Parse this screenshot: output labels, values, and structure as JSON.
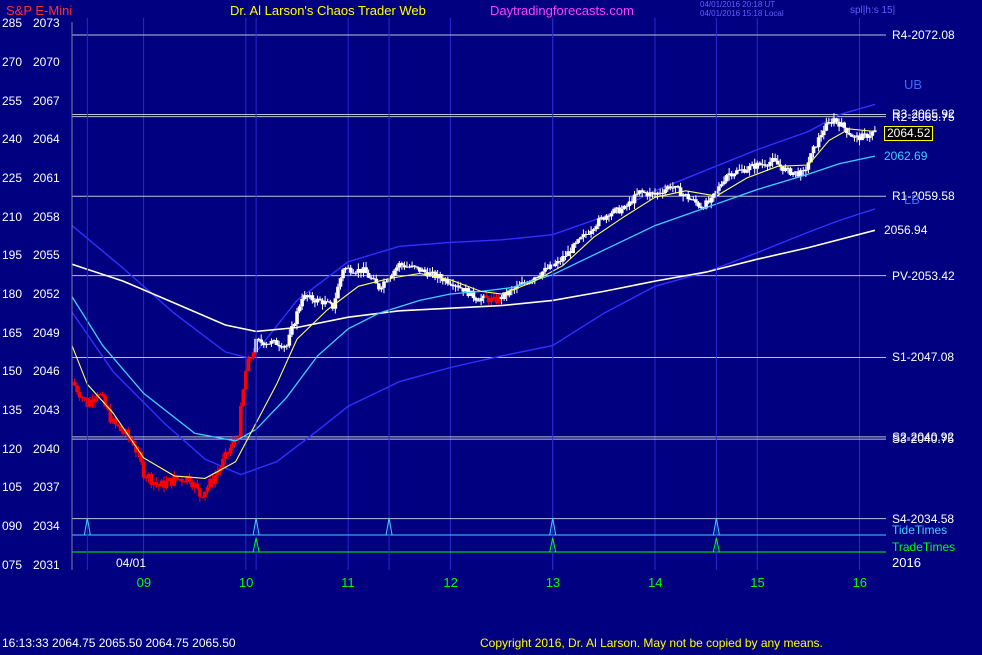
{
  "header": {
    "symbol": "S&P E-Mini",
    "title": "Dr. Al Larson's Chaos Trader Web",
    "site": "Daytradingforecasts.com",
    "stamp_line1": "04/01/2016 20:18 UT",
    "stamp_line2": "04/01/2016 15:18 Local",
    "spl": "spl|h:s 15|"
  },
  "footer": {
    "quote": "16:13:33  2064.75  2065.50  2064.75  2065.50",
    "copyright": "Copyright 2016, Dr. Al Larson. May not be copied by any means."
  },
  "date_label": "04/01",
  "year_label": "2016",
  "colors": {
    "background": "#000080",
    "up_candle": "#ffffff",
    "down_candle": "#ff0000",
    "level_line": "#c0c0d8",
    "ema_short": "#ffff66",
    "ema_mid": "#40d0ff",
    "ema_long": "#ffffe0",
    "band": "#3030ff",
    "tide": "#40d0ff",
    "trade": "#00ff00",
    "symbol": "#ff3030",
    "title": "#ffff00",
    "site": "#ff40ff"
  },
  "chart_data": {
    "type": "candlestick",
    "title": "S&P E-Mini",
    "y_axis_price": {
      "ticks": [
        2031,
        2034,
        2037,
        2040,
        2043,
        2046,
        2049,
        2052,
        2055,
        2058,
        2061,
        2064,
        2067,
        2070,
        2073
      ],
      "labels": [
        "2031",
        "2034",
        "2037",
        "2040",
        "2043",
        "2046",
        "2049",
        "2052",
        "2055",
        "2058",
        "2061",
        "2064",
        "2067",
        "2070",
        "2073"
      ],
      "range": [
        2030.6,
        2073.4
      ]
    },
    "y_axis_index": [
      "075",
      "090",
      "105",
      "120",
      "135",
      "150",
      "165",
      "180",
      "195",
      "210",
      "225",
      "240",
      "255",
      "270",
      "285"
    ],
    "x_axis": {
      "range": [
        8.3,
        16.2
      ],
      "ticks": [
        9,
        10,
        11,
        12,
        13,
        14,
        15,
        16
      ],
      "labels": [
        "09",
        "10",
        "11",
        "12",
        "13",
        "14",
        "15",
        "16"
      ],
      "hour_grid": true
    },
    "levels": [
      {
        "name": "R4",
        "label": "R4-2072.08",
        "value": 2072.08
      },
      {
        "name": "R3",
        "label": "R3-2065.92",
        "value": 2065.92
      },
      {
        "name": "R2",
        "label": "R2-2065.75",
        "value": 2065.75
      },
      {
        "name": "R1",
        "label": "R1-2059.58",
        "value": 2059.58
      },
      {
        "name": "PV",
        "label": "PV-2053.42",
        "value": 2053.42
      },
      {
        "name": "S1",
        "label": "S1-2047.08",
        "value": 2047.08
      },
      {
        "name": "S2",
        "label": "S2-2040.92",
        "value": 2040.92
      },
      {
        "name": "S3",
        "label": "S3-2040.75",
        "value": 2040.75
      },
      {
        "name": "S4",
        "label": "S4-2034.58",
        "value": 2034.58
      }
    ],
    "value_labels": [
      {
        "label": "2064.52",
        "value": 2064.52,
        "color": "#ffffff",
        "box": true
      },
      {
        "label": "2062.69",
        "value": 2062.69,
        "color": "#40d0ff",
        "box": false
      },
      {
        "label": "2056.94",
        "value": 2056.94,
        "color": "#ffffff",
        "box": false
      }
    ],
    "band_labels": {
      "upper": "UB",
      "lower": "LB"
    },
    "tide_times": {
      "label": "TideTimes",
      "times": [
        8.45,
        10.1,
        11.4,
        13.0,
        14.6
      ]
    },
    "trade_times": {
      "label": "TradeTimes",
      "times": [
        10.1,
        13.0,
        14.6
      ]
    },
    "candle_path": [
      [
        8.3,
        2045.2
      ],
      [
        8.45,
        2043.5
      ],
      [
        8.55,
        2044.5
      ],
      [
        8.7,
        2042.0
      ],
      [
        8.9,
        2040.5
      ],
      [
        9.0,
        2038.2
      ],
      [
        9.15,
        2037.1
      ],
      [
        9.3,
        2037.6
      ],
      [
        9.45,
        2037.8
      ],
      [
        9.55,
        2036.4
      ],
      [
        9.65,
        2037.3
      ],
      [
        9.75,
        2038.6
      ],
      [
        9.82,
        2039.6
      ],
      [
        9.92,
        2041.0
      ],
      [
        10.0,
        2046.0
      ],
      [
        10.1,
        2048.3
      ],
      [
        10.3,
        2048.2
      ],
      [
        10.4,
        2048.0
      ],
      [
        10.55,
        2051.8
      ],
      [
        10.75,
        2051.4
      ],
      [
        10.85,
        2051.0
      ],
      [
        10.95,
        2054.0
      ],
      [
        11.15,
        2053.8
      ],
      [
        11.3,
        2052.5
      ],
      [
        11.5,
        2054.3
      ],
      [
        11.65,
        2054.0
      ],
      [
        11.85,
        2053.4
      ],
      [
        12.05,
        2052.8
      ],
      [
        12.25,
        2051.7
      ],
      [
        12.45,
        2051.5
      ],
      [
        12.65,
        2052.5
      ],
      [
        12.85,
        2053.5
      ],
      [
        13.05,
        2054.4
      ],
      [
        13.2,
        2055.6
      ],
      [
        13.4,
        2057.3
      ],
      [
        13.55,
        2058.3
      ],
      [
        13.7,
        2058.6
      ],
      [
        13.85,
        2059.9
      ],
      [
        14.0,
        2059.7
      ],
      [
        14.15,
        2060.4
      ],
      [
        14.3,
        2059.6
      ],
      [
        14.45,
        2058.8
      ],
      [
        14.55,
        2059.2
      ],
      [
        14.7,
        2061.3
      ],
      [
        14.85,
        2061.6
      ],
      [
        15.0,
        2062.0
      ],
      [
        15.15,
        2062.3
      ],
      [
        15.3,
        2061.5
      ],
      [
        15.45,
        2061.3
      ],
      [
        15.55,
        2063.2
      ],
      [
        15.65,
        2064.8
      ],
      [
        15.75,
        2065.6
      ],
      [
        15.85,
        2064.9
      ],
      [
        15.95,
        2064.1
      ],
      [
        16.05,
        2064.2
      ],
      [
        16.15,
        2064.6
      ]
    ],
    "ema_short": [
      [
        8.3,
        2048.0
      ],
      [
        8.45,
        2045.0
      ],
      [
        8.7,
        2042.8
      ],
      [
        9.0,
        2039.3
      ],
      [
        9.3,
        2037.9
      ],
      [
        9.6,
        2037.7
      ],
      [
        9.9,
        2039.0
      ],
      [
        10.1,
        2042.0
      ],
      [
        10.3,
        2045.0
      ],
      [
        10.5,
        2048.5
      ],
      [
        10.8,
        2050.8
      ],
      [
        11.1,
        2052.6
      ],
      [
        11.4,
        2053.2
      ],
      [
        11.7,
        2053.6
      ],
      [
        12.0,
        2053.1
      ],
      [
        12.3,
        2052.2
      ],
      [
        12.5,
        2052.0
      ],
      [
        12.8,
        2052.9
      ],
      [
        13.1,
        2054.2
      ],
      [
        13.4,
        2056.4
      ],
      [
        13.7,
        2058.0
      ],
      [
        14.0,
        2059.5
      ],
      [
        14.3,
        2060.0
      ],
      [
        14.6,
        2059.6
      ],
      [
        14.9,
        2061.0
      ],
      [
        15.2,
        2061.9
      ],
      [
        15.5,
        2062.0
      ],
      [
        15.7,
        2063.9
      ],
      [
        15.9,
        2064.8
      ],
      [
        16.15,
        2064.6
      ]
    ],
    "ema_mid": [
      [
        8.3,
        2051.8
      ],
      [
        8.6,
        2048.0
      ],
      [
        9.0,
        2044.3
      ],
      [
        9.5,
        2041.2
      ],
      [
        9.9,
        2040.6
      ],
      [
        10.1,
        2041.5
      ],
      [
        10.4,
        2044.0
      ],
      [
        10.7,
        2047.2
      ],
      [
        11.0,
        2049.3
      ],
      [
        11.3,
        2050.5
      ],
      [
        11.7,
        2051.5
      ],
      [
        12.0,
        2052.0
      ],
      [
        12.3,
        2052.2
      ],
      [
        12.6,
        2052.5
      ],
      [
        13.0,
        2053.5
      ],
      [
        13.5,
        2055.4
      ],
      [
        14.0,
        2057.3
      ],
      [
        14.5,
        2058.7
      ],
      [
        15.0,
        2060.1
      ],
      [
        15.5,
        2061.3
      ],
      [
        15.8,
        2062.1
      ],
      [
        16.15,
        2062.69
      ]
    ],
    "ema_long": [
      [
        8.3,
        2054.3
      ],
      [
        8.8,
        2053.0
      ],
      [
        9.3,
        2051.3
      ],
      [
        9.8,
        2049.6
      ],
      [
        10.1,
        2049.1
      ],
      [
        10.5,
        2049.4
      ],
      [
        11.0,
        2050.2
      ],
      [
        11.5,
        2050.7
      ],
      [
        12.0,
        2050.9
      ],
      [
        12.5,
        2051.1
      ],
      [
        13.0,
        2051.5
      ],
      [
        13.5,
        2052.2
      ],
      [
        14.0,
        2053.0
      ],
      [
        14.5,
        2053.7
      ],
      [
        15.0,
        2054.7
      ],
      [
        15.5,
        2055.6
      ],
      [
        16.15,
        2056.94
      ]
    ],
    "band_upper": [
      [
        8.3,
        2057.3
      ],
      [
        8.8,
        2054.0
      ],
      [
        9.3,
        2050.5
      ],
      [
        9.8,
        2047.5
      ],
      [
        10.05,
        2047.0
      ],
      [
        10.5,
        2051.5
      ],
      [
        11.0,
        2054.5
      ],
      [
        11.5,
        2055.7
      ],
      [
        12.0,
        2056.0
      ],
      [
        12.5,
        2056.2
      ],
      [
        13.0,
        2056.6
      ],
      [
        13.5,
        2058.0
      ],
      [
        14.0,
        2060.0
      ],
      [
        14.5,
        2061.6
      ],
      [
        15.0,
        2063.2
      ],
      [
        15.5,
        2064.6
      ],
      [
        15.8,
        2065.9
      ],
      [
        16.15,
        2066.7
      ]
    ],
    "band_lower": [
      [
        8.3,
        2050.6
      ],
      [
        8.7,
        2046.0
      ],
      [
        9.2,
        2042.0
      ],
      [
        9.6,
        2039.2
      ],
      [
        9.95,
        2038.0
      ],
      [
        10.3,
        2039.0
      ],
      [
        10.7,
        2041.4
      ],
      [
        11.0,
        2043.3
      ],
      [
        11.5,
        2045.2
      ],
      [
        12.0,
        2046.3
      ],
      [
        12.5,
        2047.2
      ],
      [
        13.0,
        2048.0
      ],
      [
        13.5,
        2050.5
      ],
      [
        14.0,
        2052.6
      ],
      [
        14.5,
        2053.7
      ],
      [
        15.0,
        2055.2
      ],
      [
        15.5,
        2056.8
      ],
      [
        15.8,
        2057.7
      ],
      [
        16.15,
        2058.6
      ]
    ]
  }
}
